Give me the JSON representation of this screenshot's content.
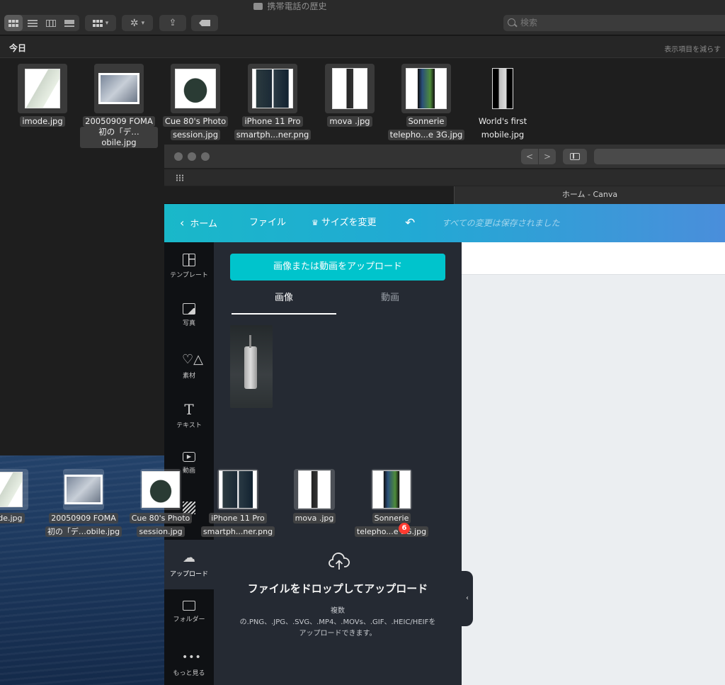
{
  "finder": {
    "title": "携帯電話の歴史",
    "search_placeholder": "検索",
    "section_title": "今日",
    "show_less": "表示項目を減らす",
    "files": [
      {
        "line1": "imode.jpg",
        "line2": ""
      },
      {
        "line1": "20050909 FOMA",
        "line2": "初の「デ…obile.jpg"
      },
      {
        "line1": "Cue 80's Photo",
        "line2": "session.jpg"
      },
      {
        "line1": "iPhone 11 Pro",
        "line2": "smartph...ner.png"
      },
      {
        "line1": "mova .jpg",
        "line2": ""
      },
      {
        "line1": "Sonnerie",
        "line2": "telepho...e 3G.jpg"
      },
      {
        "line1": "World's first",
        "line2": "mobile.jpg"
      }
    ]
  },
  "browser": {
    "tab_title": "ホーム - Canva",
    "nav_back": "<",
    "nav_forward": ">"
  },
  "canva": {
    "header": {
      "home": "ホーム",
      "file": "ファイル",
      "resize": "サイズを変更",
      "saved": "すべての変更は保存されました"
    },
    "rail": [
      {
        "label": "テンプレート",
        "icon": "template-icon"
      },
      {
        "label": "写真",
        "icon": "photo-icon"
      },
      {
        "label": "素材",
        "icon": "elements-icon"
      },
      {
        "label": "テキスト",
        "icon": "text-icon"
      },
      {
        "label": "動画",
        "icon": "video-icon"
      },
      {
        "label": "背景",
        "icon": "background-icon"
      },
      {
        "label": "アップロード",
        "icon": "upload-icon"
      },
      {
        "label": "フォルダー",
        "icon": "folder-icon"
      },
      {
        "label": "もっと見る",
        "icon": "more-icon"
      }
    ],
    "panel": {
      "upload_button": "画像または動画をアップロード",
      "tab_images": "画像",
      "tab_videos": "動画",
      "drop_title": "ファイルをドロップしてアップロード",
      "drop_line1": "複数",
      "drop_line2": "の.PNG、.JPG、.SVG、.MP4、.MOVs、.GIF、.HEIC/HEIFを",
      "drop_line3": "アップロードできます。"
    }
  },
  "drag": {
    "count": "6",
    "items": [
      {
        "line1": "ode.jpg",
        "line2": ""
      },
      {
        "line1": "20050909 FOMA",
        "line2": "初の「デ…obile.jpg"
      },
      {
        "line1": "Cue 80's Photo",
        "line2": "session.jpg"
      },
      {
        "line1": "iPhone 11 Pro",
        "line2": "smartph...ner.png"
      },
      {
        "line1": "mova .jpg",
        "line2": ""
      },
      {
        "line1": "Sonnerie",
        "line2": "telepho...e 3G.jpg"
      }
    ]
  }
}
